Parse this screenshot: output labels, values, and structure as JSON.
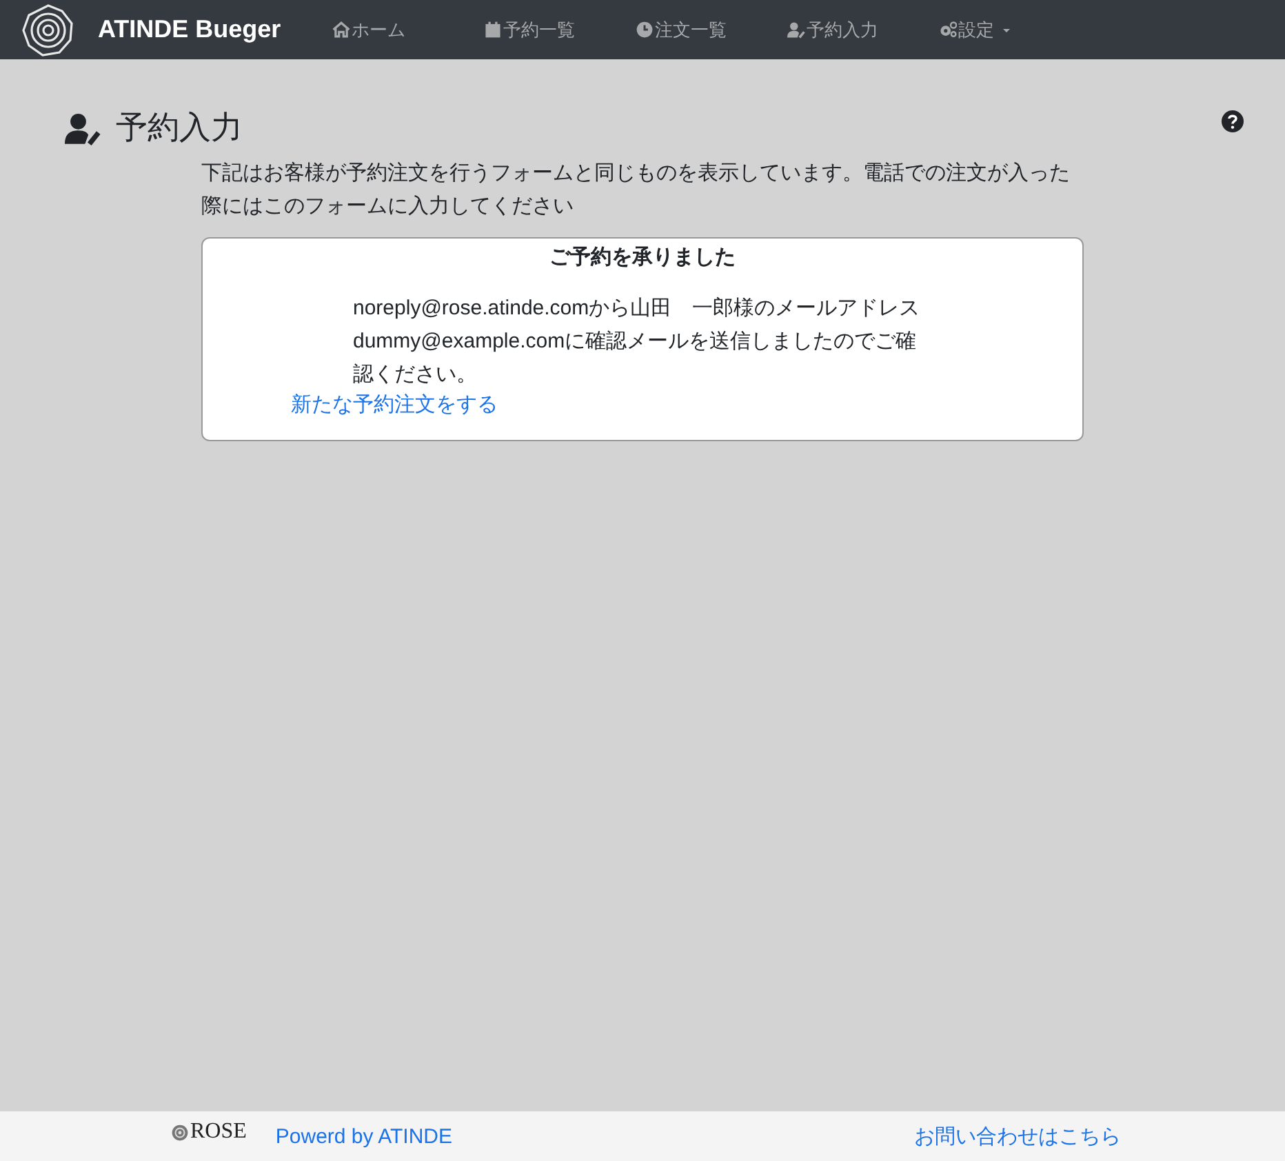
{
  "navbar": {
    "brand": "ATINDE Bueger",
    "items": [
      {
        "kind": "home",
        "label": "ホーム"
      },
      {
        "kind": "calendar",
        "label": "予約一覧"
      },
      {
        "kind": "clock",
        "label": "注文一覧"
      },
      {
        "kind": "user-edit",
        "label": "予約入力"
      },
      {
        "kind": "gears",
        "label": "設定",
        "dropdown": true
      }
    ]
  },
  "page": {
    "title": "予約入力",
    "description": "下記はお客様が予約注文を行うフォームと同じものを表示しています。電話での注文が入った際にはこのフォームに入力してください"
  },
  "card": {
    "title": "ご予約を承りました",
    "message": "noreply@rose.atinde.comから山田　一郎様のメールアドレスdummy@example.comに確認メールを送信しましたのでご確認ください。",
    "link": "新たな予約注文をする"
  },
  "footer": {
    "logo_text": "ROSE",
    "powered": "Powerd by ATINDE",
    "contact": "お問い合わせはこちら"
  }
}
